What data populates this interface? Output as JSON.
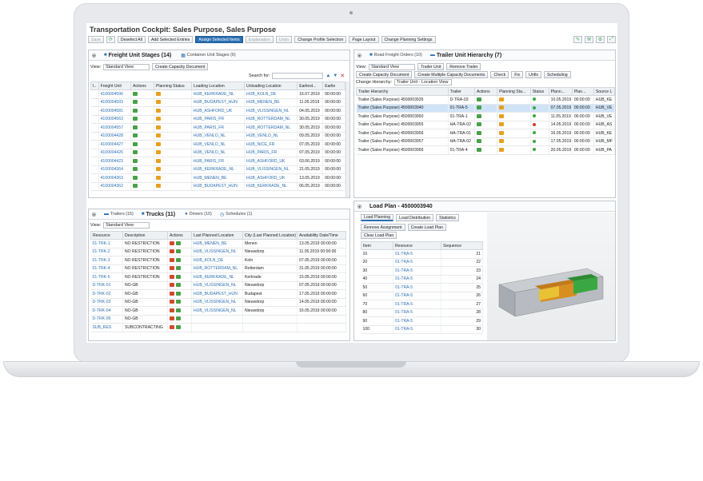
{
  "app": {
    "title": "Transportation Cockpit: Sales Purpose, Sales Purpose"
  },
  "toolbar": {
    "save": "Save",
    "deselect_all": "Deselect All",
    "add_selected": "Add Selected Entries",
    "assign_selected": "Assign Selected Items",
    "explanation": "Explanation",
    "undo": "Undo",
    "change_profile": "Change Profile Selection",
    "page_layout": "Page Layout",
    "change_planning": "Change Planning Settings"
  },
  "fu": {
    "tab1": "Freight Unit Stages (14)",
    "tab2": "Container Unit Stages (6)",
    "view_label": "View:",
    "view_value": "Standard View",
    "create_cap": "Create Capacity Document",
    "search_label": "Search for:",
    "headers": [
      "I..",
      "Freight Unit",
      "Actions",
      "Planning Status",
      "Loading Location",
      "Unloading Location",
      "Earliest...",
      "Earlie"
    ],
    "rows": [
      [
        "4100004596",
        "HUB_KERKRADE_NL",
        "HUB_KOLN_DE",
        "16.07.2019",
        "00:00:00"
      ],
      [
        "4100004593",
        "HUB_BUDAPEST_HUN",
        "HUB_MENEN_BE",
        "11.05.2019",
        "00:00:00"
      ],
      [
        "4100004581",
        "HUB_ASHFORD_UK",
        "HUB_VLISSINGEN_NL",
        "04.05.2019",
        "00:00:00"
      ],
      [
        "4100004563",
        "HUB_PARIS_FR",
        "HUB_ROTTERDAM_NL",
        "30.05.2019",
        "00:00:00"
      ],
      [
        "4100004557",
        "HUB_PARIS_FR",
        "HUB_ROTTERDAM_NL",
        "30.05.2019",
        "00:00:00"
      ],
      [
        "4100004428",
        "HUB_VENLO_NL",
        "HUB_VENLO_NL",
        "09.05.2019",
        "00:00:00"
      ],
      [
        "4100004427",
        "HUB_VENLO_NL",
        "HUB_NICE_FR",
        "07.05.2019",
        "00:00:00"
      ],
      [
        "4100004426",
        "HUB_VENLO_NL",
        "HUB_PARIS_FR",
        "07.05.2019",
        "00:00:00"
      ],
      [
        "4100004423",
        "HUB_PARIS_FR",
        "HUB_ASHFORD_UK",
        "03.06.2019",
        "00:00:00"
      ],
      [
        "4100004364",
        "HUB_KERKRADE_NL",
        "HUB_VLISSINGEN_NL",
        "21.05.2019",
        "00:00:00"
      ],
      [
        "4100004363",
        "HUB_MENEN_BE",
        "HUB_ASHFORD_UK",
        "13.05.2019",
        "00:00:00"
      ],
      [
        "4100004362",
        "HUB_BUDAPEST_HUN",
        "HUB_KERKRADE_NL",
        "06.05.2019",
        "00:00:00"
      ]
    ]
  },
  "tu": {
    "tab1": "Road Freight Orders (10)",
    "tab2": "Trailer Unit Hierarchy (7)",
    "view_label": "View:",
    "view_value": "Standard View",
    "trailer_unit": "Trailer Unit",
    "remove_trailer": "Remove Trailer",
    "create_cap": "Create Capacity Document",
    "create_multi": "Create Multiple Capacity Documents",
    "check": "Check",
    "fix": "Fix",
    "unfix": "Unfix",
    "scheduling": "Scheduling",
    "change_hier_label": "Change Hierarchy:",
    "change_hier_value": "Trailer Unit - Location View",
    "headers": [
      "Trailer Hierarchy",
      "Trailer",
      "Actions",
      "Planning Sta...",
      "Status",
      "Plann...",
      "Plan...",
      "Source L"
    ],
    "rows": [
      [
        "Trailer (Sales Purpose) 4500003935",
        "D-TRA-03",
        "",
        "10.05.2019",
        "00:00:00",
        "HUB_KE"
      ],
      [
        "Trailer (Sales Purpose) 4500003940",
        "01-TRA-5",
        "",
        "07.05.2019",
        "00:00:00",
        "HUB_VE"
      ],
      [
        "Trailer (Sales Purpose) 4500003950",
        "01-TRA-1",
        "",
        "11.05.2019",
        "00:00:00",
        "HUB_VE"
      ],
      [
        "Trailer (Sales Purpose) 4500003955",
        "HA-TRA-02",
        "",
        "14.05.2019",
        "00:00:00",
        "HUB_AS"
      ],
      [
        "Trailer (Sales Purpose) 4500003956",
        "HA-TRA-01",
        "",
        "16.05.2019",
        "00:00:00",
        "HUB_KE"
      ],
      [
        "Trailer (Sales Purpose) 4500003957",
        "HA-TRA-02",
        "",
        "17.05.2019",
        "00:00:00",
        "HUB_MF"
      ],
      [
        "Trailer (Sales Purpose) 4500003966",
        "01-TRA-4",
        "",
        "20.05.2019",
        "00:00:00",
        "HUB_PA"
      ]
    ]
  },
  "tr": {
    "tab1": "Trailers (15)",
    "tab2": "Trucks (11)",
    "tab3": "Drivers (10)",
    "tab4": "Schedules (1)",
    "view_label": "View:",
    "view_value": "Standard View",
    "headers": [
      "Resource",
      "Description",
      "Actions",
      "Last Planned Location",
      "City (Last Planned Location)",
      "Availability Date/Time"
    ],
    "rows": [
      [
        "01-TRK-1",
        "NO RESTRICTION",
        "HUB_MENEN_BE",
        "Menen",
        "13.05.2019 00:00:00"
      ],
      [
        "01-TRK-2",
        "NO RESTRICTION",
        "HUB_VLISSINGEN_NL",
        "Nieuwdorp",
        "11.05.2019 00:00:00"
      ],
      [
        "01-TRK-3",
        "NO RESTRICTION",
        "HUB_KOLN_DE",
        "Koln",
        "07.05.2019 00:00:00"
      ],
      [
        "01-TRK-4",
        "NO RESTRICTION",
        "HUB_ROTTERDAM_NL",
        "Rotterdam",
        "31.05.2019 00:00:00"
      ],
      [
        "01-TRK-5",
        "NO RESTRICTION",
        "HUB_KERKRADE_NL",
        "Kerkrade",
        "15.05.2019 00:00:00"
      ],
      [
        "D-TRK-01",
        "NO-GB",
        "HUB_VLISSINGEN_NL",
        "Nieuwdorp",
        "07.05.2019 00:00:00"
      ],
      [
        "D-TRK-02",
        "NO-GB",
        "HUB_BUDAPEST_HUN",
        "Budapest",
        "17.05.2019 00:00:00"
      ],
      [
        "D-TRK-03",
        "NO-GB",
        "HUB_VLISSINGEN_NL",
        "Nieuwdorp",
        "14.05.2019 00:00:00"
      ],
      [
        "D-TRK-04",
        "NO-GB",
        "HUB_VLISSINGEN_NL",
        "Nieuwdorp",
        "16.05.2019 00:00:00"
      ],
      [
        "D-TRK-05",
        "NO-GB",
        "",
        "",
        ""
      ],
      [
        "SUB_RES",
        "SUBCONTRACTING",
        "",
        "",
        ""
      ]
    ]
  },
  "lp": {
    "title": "Load Plan - 4500003940",
    "tab1": "Load Planning",
    "tab2": "Load Distribution",
    "tab3": "Statistics",
    "remove": "Remove Assignment",
    "create": "Create Load Plan",
    "clear": "Clear Load Plan",
    "headers": [
      "Item",
      "Resource",
      "Sequence"
    ],
    "rows": [
      [
        "10",
        "01-TRA-5",
        "21"
      ],
      [
        "20",
        "01-TRA-5",
        "22"
      ],
      [
        "30",
        "01-TRA-5",
        "23"
      ],
      [
        "40",
        "01-TRA-5",
        "24"
      ],
      [
        "50",
        "01-TRA-5",
        "25"
      ],
      [
        "60",
        "01-TRA-5",
        "26"
      ],
      [
        "70",
        "01-TRA-5",
        "27"
      ],
      [
        "80",
        "01-TRA-5",
        "28"
      ],
      [
        "90",
        "01-TRA-5",
        "29"
      ],
      [
        "100",
        "01-TRA-5",
        "30"
      ]
    ]
  }
}
